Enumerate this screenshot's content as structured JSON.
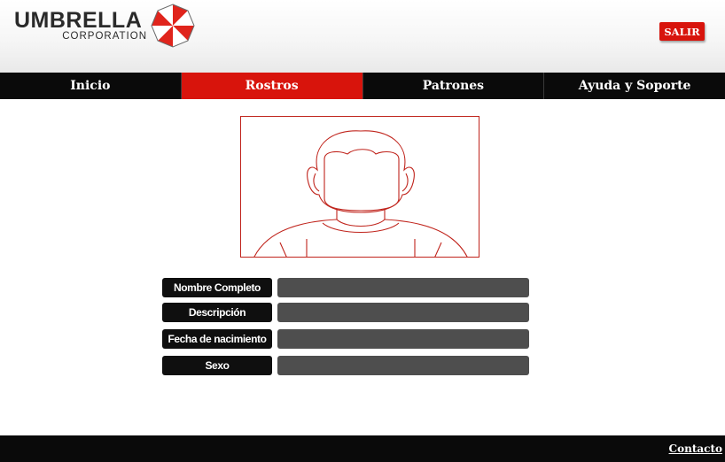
{
  "brand": {
    "name": "UMBRELLA",
    "subtitle": "CORPORATION",
    "colors": {
      "primary": "#d8140c",
      "dark": "#0a0a0a",
      "field": "#4e4e4e"
    }
  },
  "header": {
    "exit_label": "SALIR"
  },
  "nav": {
    "items": [
      {
        "label": "Inicio",
        "active": false
      },
      {
        "label": "Rostros",
        "active": true
      },
      {
        "label": "Patrones",
        "active": false
      },
      {
        "label": "Ayuda y Soporte",
        "active": false
      }
    ]
  },
  "photo": {
    "icon": "person-silhouette-icon"
  },
  "form": {
    "fields": [
      {
        "label": "Nombre Completo",
        "value": ""
      },
      {
        "label": "Descripción",
        "value": ""
      },
      {
        "label": "Fecha de nacimiento",
        "value": ""
      },
      {
        "label": "Sexo",
        "value": ""
      }
    ]
  },
  "footer": {
    "contact_label": "Contacto"
  }
}
